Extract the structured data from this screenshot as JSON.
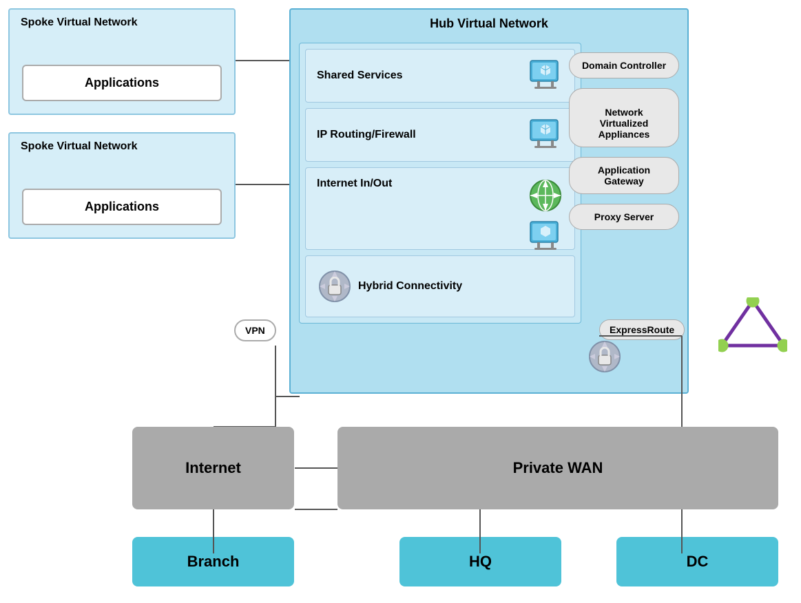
{
  "spoke1": {
    "title": "Spoke Virtual Network",
    "app_label": "Applications"
  },
  "spoke2": {
    "title": "Spoke Virtual Network",
    "app_label": "Applications"
  },
  "hub": {
    "title": "Hub Virtual Network",
    "services": [
      {
        "id": "shared-services",
        "label": "Shared Services",
        "icon": "monitor-blue"
      },
      {
        "id": "ip-routing",
        "label": "IP Routing/Firewall",
        "icon": "monitor-blue"
      },
      {
        "id": "internet-inout",
        "label": "Internet In/Out",
        "icon_top": "globe-green",
        "icon_bottom": "monitor-blue"
      },
      {
        "id": "hybrid-connectivity",
        "label": "Hybrid Connectivity",
        "icon": "lock-gray"
      }
    ],
    "right_labels": [
      {
        "id": "domain-controller",
        "label": "Domain Controller"
      },
      {
        "id": "network-virtualized",
        "label": "Network  Virtualized\nAppliances"
      },
      {
        "id": "application-gateway",
        "label": "Application Gateway"
      },
      {
        "id": "proxy-server",
        "label": "Proxy Server"
      }
    ]
  },
  "vpn": {
    "label": "VPN"
  },
  "expressroute": {
    "label": "ExpressRoute"
  },
  "internet": {
    "label": "Internet"
  },
  "private_wan": {
    "label": "Private WAN"
  },
  "destinations": [
    {
      "id": "branch",
      "label": "Branch"
    },
    {
      "id": "hq",
      "label": "HQ"
    },
    {
      "id": "dc",
      "label": "DC"
    }
  ]
}
